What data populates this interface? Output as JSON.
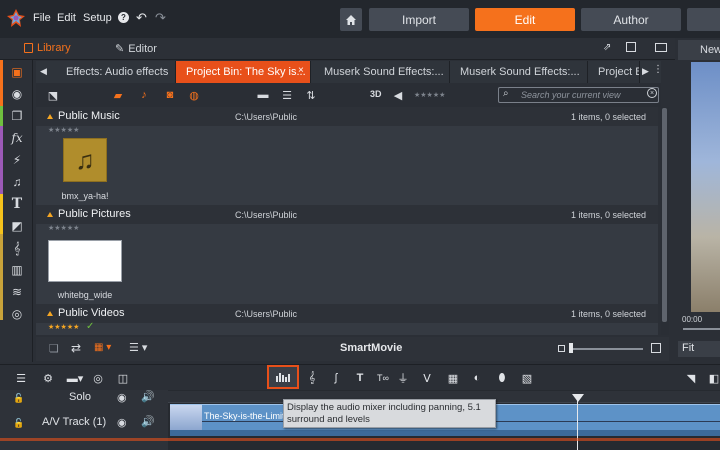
{
  "menu": {
    "file": "File",
    "edit": "Edit",
    "setup": "Setup",
    "help": "?"
  },
  "modes": {
    "import": "Import",
    "edit": "Edit",
    "author": "Author"
  },
  "library_header": {
    "library": "Library",
    "editor": "Editor"
  },
  "tabs": [
    {
      "label": "Effects: Audio effects"
    },
    {
      "label": "Project Bin: The Sky is..."
    },
    {
      "label": "Muserk Sound Effects:..."
    },
    {
      "label": "Muserk Sound Effects:..."
    },
    {
      "label": "Project B"
    }
  ],
  "toolbar": {
    "threed": "3D",
    "search_placeholder": "Search your current view"
  },
  "sections": [
    {
      "title": "Public Music",
      "path": "C:\\Users\\Public",
      "count": "1 items, 0 selected",
      "item_label": "bmx_ya-ha!",
      "stars": "★★★★★"
    },
    {
      "title": "Public Pictures",
      "path": "C:\\Users\\Public",
      "count": "1 items, 0 selected",
      "item_label": "whitebg_wide",
      "stars": "★★★★★"
    },
    {
      "title": "Public Videos",
      "path": "C:\\Users\\Public",
      "count": "1 items, 0 selected",
      "stars": "★★★★★",
      "check": "✓"
    }
  ],
  "library_bottom": {
    "smartmovie": "SmartMovie"
  },
  "preview": {
    "new_label": "New",
    "fit": "Fit",
    "timecode": "00:00"
  },
  "timeline": {
    "solo": "Solo",
    "track": "A/V Track (1)",
    "clip_title": "The-Sky-is-the-Limit",
    "tooltip": "Display the audio mixer including panning, 5.1 surround and levels"
  },
  "colors": {
    "accent": "#f5711c",
    "tab_active": "#e8501a",
    "clip": "#5d92c7"
  }
}
